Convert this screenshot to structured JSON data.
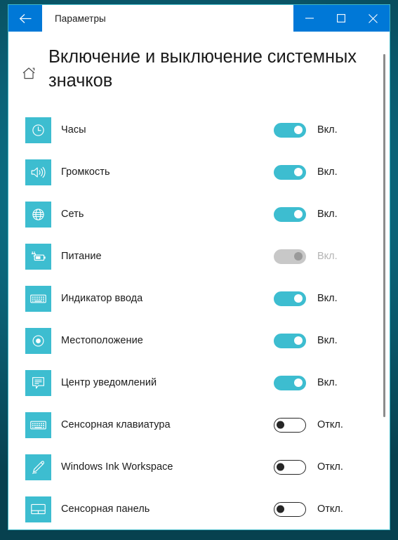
{
  "titlebar": {
    "back_icon": "arrow-left-icon",
    "app_title": "Параметры",
    "minimize_icon": "minimize-icon",
    "maximize_icon": "maximize-icon",
    "close_icon": "close-icon",
    "accent_color": "#0078d7"
  },
  "page": {
    "home_icon": "home-icon",
    "title": "Включение и выключение системных значков",
    "accent_color": "#3dbdd0"
  },
  "settings": [
    {
      "icon": "clock-icon",
      "label": "Часы",
      "state_label": "Вкл.",
      "state": "on"
    },
    {
      "icon": "volume-icon",
      "label": "Громкость",
      "state_label": "Вкл.",
      "state": "on"
    },
    {
      "icon": "network-globe-icon",
      "label": "Сеть",
      "state_label": "Вкл.",
      "state": "on"
    },
    {
      "icon": "battery-plug-icon",
      "label": "Питание",
      "state_label": "Вкл.",
      "state": "disabled"
    },
    {
      "icon": "keyboard-icon",
      "label": "Индикатор ввода",
      "state_label": "Вкл.",
      "state": "on"
    },
    {
      "icon": "location-icon",
      "label": "Местоположение",
      "state_label": "Вкл.",
      "state": "on"
    },
    {
      "icon": "notification-icon",
      "label": "Центр уведомлений",
      "state_label": "Вкл.",
      "state": "on"
    },
    {
      "icon": "touch-keyboard-icon",
      "label": "Сенсорная клавиатура",
      "state_label": "Откл.",
      "state": "off"
    },
    {
      "icon": "pen-icon",
      "label": "Windows Ink Workspace",
      "state_label": "Откл.",
      "state": "off"
    },
    {
      "icon": "touchpad-icon",
      "label": "Сенсорная панель",
      "state_label": "Откл.",
      "state": "off"
    }
  ],
  "scrollbar": {
    "name": "vertical-scrollbar"
  }
}
